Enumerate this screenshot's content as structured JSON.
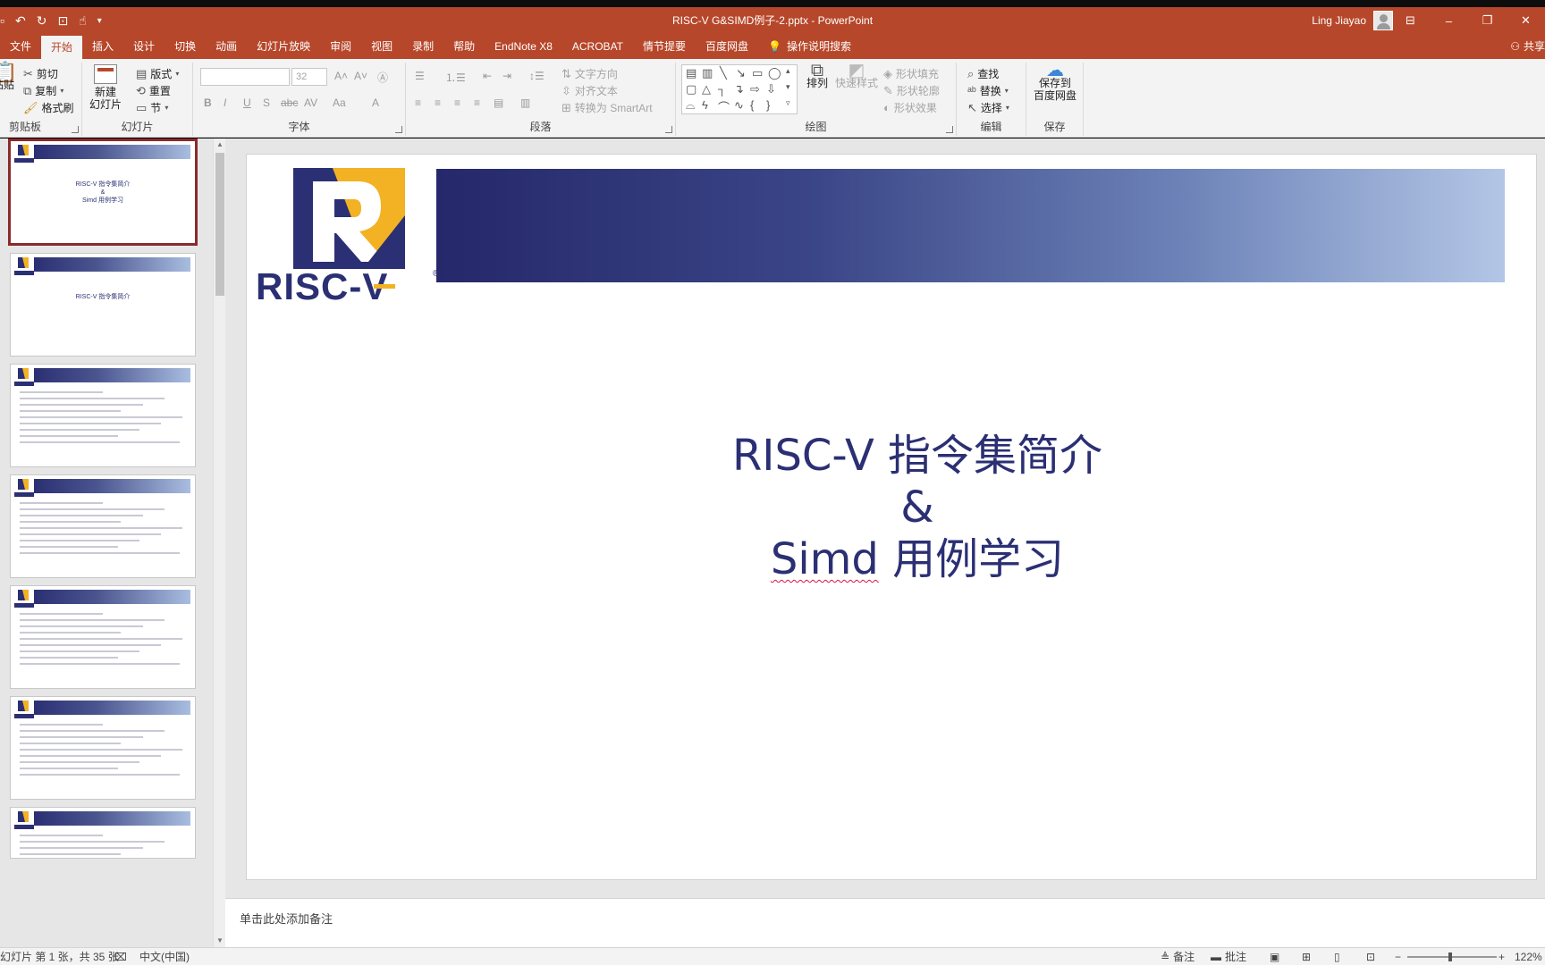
{
  "titlebar": {
    "doc_title": "RISC-V G&SIMD例子-2.pptx  -  PowerPoint",
    "user_name": "Ling Jiayao",
    "qat_icons": [
      "save-icon",
      "undo-icon",
      "redo-icon",
      "present-icon",
      "touch-icon",
      "customize-icon"
    ]
  },
  "tabs": [
    {
      "label": "文件"
    },
    {
      "label": "开始",
      "active": true
    },
    {
      "label": "插入"
    },
    {
      "label": "设计"
    },
    {
      "label": "切换"
    },
    {
      "label": "动画"
    },
    {
      "label": "幻灯片放映"
    },
    {
      "label": "审阅"
    },
    {
      "label": "视图"
    },
    {
      "label": "录制"
    },
    {
      "label": "帮助"
    },
    {
      "label": "EndNote X8"
    },
    {
      "label": "ACROBAT"
    },
    {
      "label": "情节提要"
    },
    {
      "label": "百度网盘"
    }
  ],
  "tellme": "操作说明搜索",
  "share": "共享",
  "ribbon": {
    "clipboard": {
      "label": "剪贴板",
      "paste": "粘贴",
      "cut": "剪切",
      "copy": "复制",
      "format_painter": "格式刷"
    },
    "slides": {
      "label": "幻灯片",
      "new_slide": "新建",
      "new_slide2": "幻灯片",
      "layout": "版式",
      "reset": "重置",
      "section": "节"
    },
    "font": {
      "label": "字体",
      "size": "32"
    },
    "paragraph": {
      "label": "段落",
      "text_direction": "文字方向",
      "align_text": "对齐文本",
      "smartart": "转换为 SmartArt"
    },
    "drawing": {
      "label": "绘图",
      "arrange": "排列",
      "quick_styles": "快速样式",
      "fill": "形状填充",
      "outline": "形状轮廓",
      "effects": "形状效果"
    },
    "editing": {
      "label": "编辑",
      "find": "查找",
      "replace": "替换",
      "select": "选择"
    },
    "save": {
      "label": "保存",
      "btn1": "保存到",
      "btn2": "百度网盘"
    }
  },
  "thumbnails": [
    {
      "num": 1,
      "line1": "RISC-V 指令集简介",
      "line2": "&",
      "line3": "Simd 用例学习"
    },
    {
      "num": 2,
      "line1": "RISC-V 指令集简介"
    },
    {
      "num": 3
    },
    {
      "num": 4
    },
    {
      "num": 5
    },
    {
      "num": 6
    },
    {
      "num": 7
    }
  ],
  "slide": {
    "logo_text": "RISC-V",
    "title_line1": "RISC-V 指令集简介",
    "title_line2": "&",
    "title_line3_a": "Simd",
    "title_line3_b": " 用例学习"
  },
  "notes_placeholder": "单击此处添加备注",
  "status": {
    "slide_info": "幻灯片 第 1 张，共 35 张",
    "language": "中文(中国)",
    "notes_btn": "备注",
    "comments_btn": "批注",
    "zoom_minus": "−",
    "zoom_plus": "+",
    "zoom_level": "122%"
  },
  "colors": {
    "accent": "#b7472a",
    "slide_title": "#2b2f73",
    "logo_gold": "#f2b223",
    "logo_navy": "#2b2f73"
  }
}
